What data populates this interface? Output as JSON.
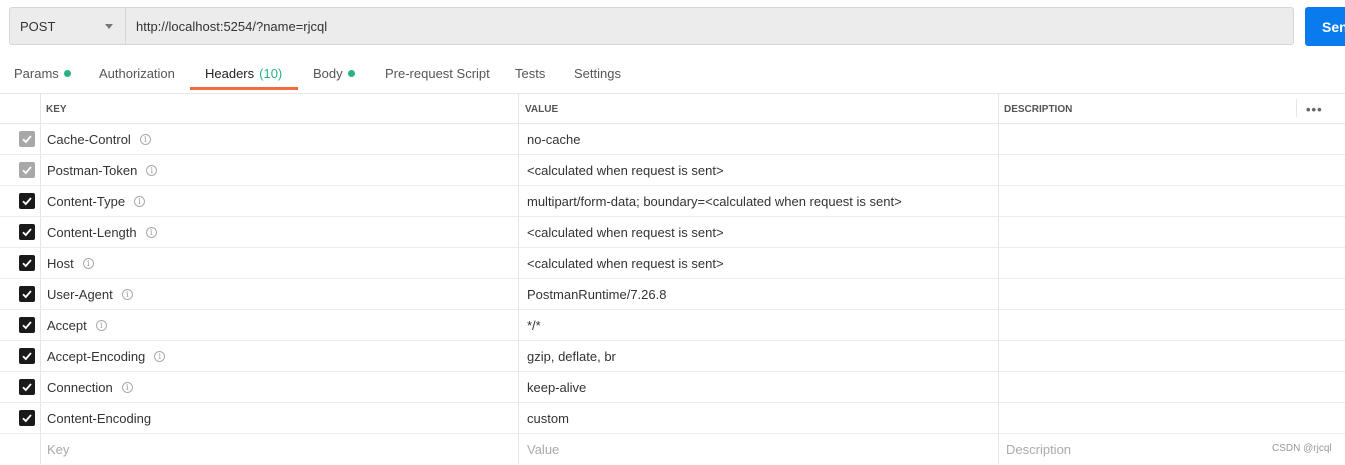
{
  "request": {
    "method": "POST",
    "url": "http://localhost:5254/?name=rjcql",
    "send_label": "Send"
  },
  "tabs": [
    {
      "label": "Params",
      "dot": true
    },
    {
      "label": "Authorization"
    },
    {
      "label": "Headers",
      "count": "(10)",
      "active": true
    },
    {
      "label": "Body",
      "dot": true
    },
    {
      "label": "Pre-request Script"
    },
    {
      "label": "Tests"
    },
    {
      "label": "Settings"
    }
  ],
  "table": {
    "headers": {
      "key": "KEY",
      "value": "VALUE",
      "description": "DESCRIPTION",
      "more": "•••"
    },
    "rows": [
      {
        "key": "Cache-Control",
        "value": "no-cache",
        "disabled": true,
        "info": true
      },
      {
        "key": "Postman-Token",
        "value": "<calculated when request is sent>",
        "disabled": true,
        "info": true
      },
      {
        "key": "Content-Type",
        "value": "multipart/form-data; boundary=<calculated when request is sent>",
        "info": true
      },
      {
        "key": "Content-Length",
        "value": "<calculated when request is sent>",
        "info": true
      },
      {
        "key": "Host",
        "value": "<calculated when request is sent>",
        "info": true
      },
      {
        "key": "User-Agent",
        "value": "PostmanRuntime/7.26.8",
        "info": true
      },
      {
        "key": "Accept",
        "value": "*/*",
        "info": true
      },
      {
        "key": "Accept-Encoding",
        "value": "gzip, deflate, br",
        "info": true
      },
      {
        "key": "Connection",
        "value": "keep-alive",
        "info": true
      },
      {
        "key": "Content-Encoding",
        "value": "custom",
        "info": false
      }
    ],
    "new_row": {
      "key_placeholder": "Key",
      "value_placeholder": "Value",
      "description_placeholder": "Description"
    }
  },
  "watermark": "CSDN @rjcql",
  "colors": {
    "accent": "#f26b3a",
    "send": "#097bed",
    "dot": "#26b47f"
  }
}
